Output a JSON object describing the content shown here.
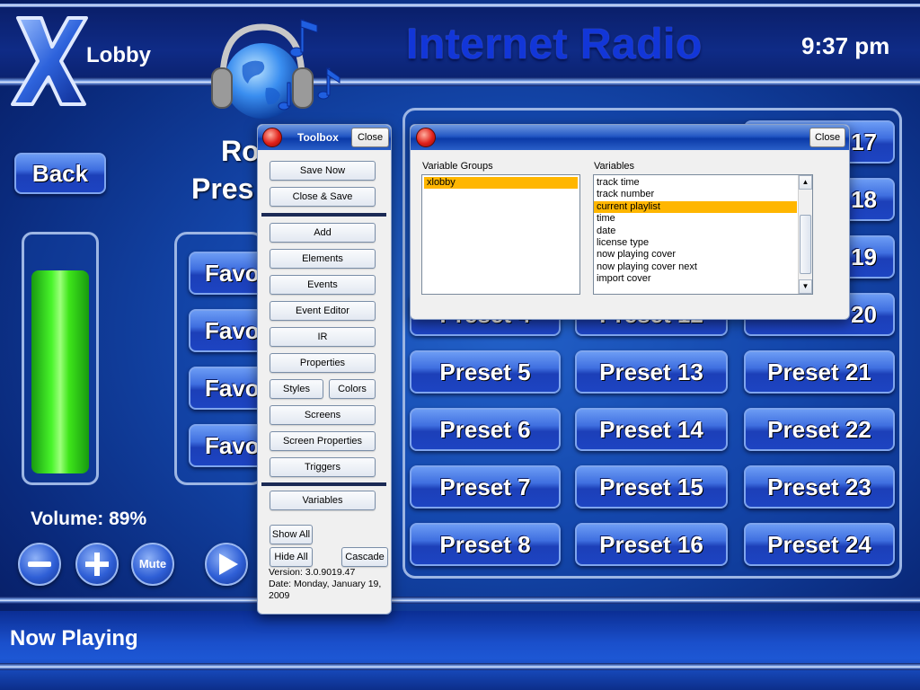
{
  "header": {
    "logo_letter": "X",
    "location": "Lobby",
    "title": "Internet Radio",
    "time": "9:37 pm"
  },
  "nav": {
    "back_label": "Back"
  },
  "left_panel": {
    "heading_line1": "Ro",
    "heading_line2": "Pres",
    "favorites": [
      "Favo",
      "Favo",
      "Favo",
      "Favo"
    ]
  },
  "volume": {
    "label": "Volume: 89%",
    "level": 0.89,
    "mute_label": "Mute",
    "minus_icon": "minus-icon",
    "plus_icon": "plus-icon",
    "play_icon": "play-icon"
  },
  "presets": {
    "col1": [
      "Preset 4",
      "Preset 5",
      "Preset 6",
      "Preset 7",
      "Preset 8"
    ],
    "col2": [
      "Preset 12",
      "Preset 13",
      "Preset 14",
      "Preset 15",
      "Preset 16"
    ],
    "col3": [
      "17",
      "18",
      "19",
      "20",
      "Preset 21",
      "Preset 22",
      "Preset 23",
      "Preset 24"
    ]
  },
  "now_playing": {
    "label": "Now Playing"
  },
  "toolbox": {
    "title": "Toolbox",
    "close": "Close",
    "save_now": "Save Now",
    "close_save": "Close & Save",
    "add": "Add",
    "elements": "Elements",
    "events": "Events",
    "event_editor": "Event Editor",
    "ir": "IR",
    "properties": "Properties",
    "styles": "Styles",
    "colors": "Colors",
    "screens": "Screens",
    "screen_properties": "Screen Properties",
    "triggers": "Triggers",
    "variables": "Variables",
    "show_all": "Show All",
    "hide_all": "Hide All",
    "cascade": "Cascade",
    "version": "Version: 3.0.9019.47",
    "date": "Date: Monday, January 19, 2009"
  },
  "variables_dialog": {
    "close": "Close",
    "groups_label": "Variable Groups",
    "variables_label": "Variables",
    "groups": [
      "xlobby"
    ],
    "selected_group": "xlobby",
    "variables": [
      "track time",
      "track number",
      "current playlist",
      "time",
      "date",
      "license type",
      "now playing cover",
      "now playing cover next",
      "import cover"
    ],
    "selected_variable": "current playlist"
  },
  "colors": {
    "accent_blue": "#1236d8",
    "volume_fill": "#3ee61a",
    "selection": "#ffb600"
  }
}
